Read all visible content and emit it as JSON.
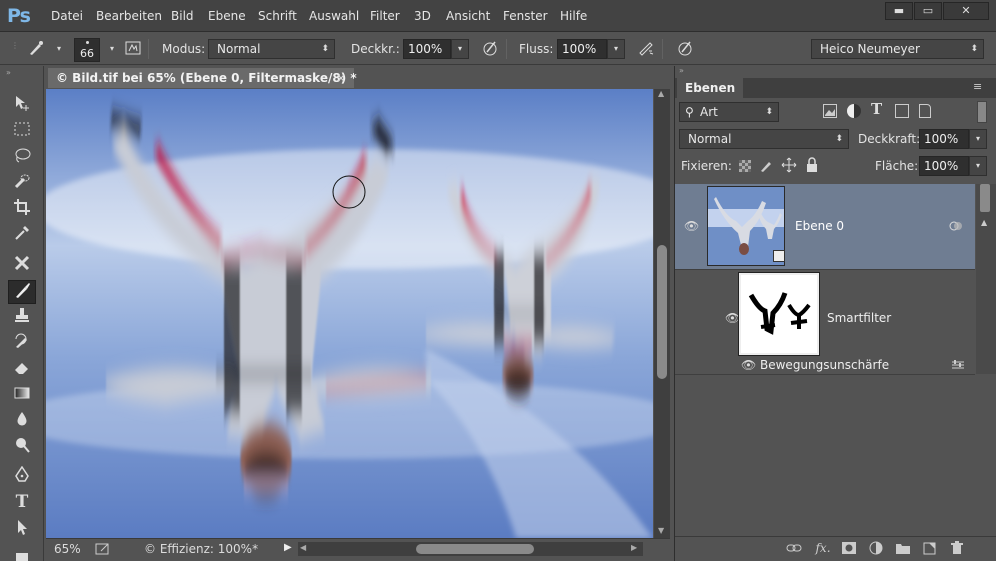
{
  "app": {
    "logo": "Ps"
  },
  "menu": [
    "Datei",
    "Bearbeiten",
    "Bild",
    "Ebene",
    "Schrift",
    "Auswahl",
    "Filter",
    "3D",
    "Ansicht",
    "Fenster",
    "Hilfe"
  ],
  "window_controls": {
    "minimize": "▬",
    "maximize": "▭",
    "close": "✕"
  },
  "options": {
    "brush_size": "66",
    "mode_label": "Modus:",
    "mode_value": "Normal",
    "opacity_label": "Deckkr.:",
    "opacity_value": "100%",
    "flow_label": "Fluss:",
    "flow_value": "100%",
    "workspace": "Heico Neumeyer"
  },
  "document": {
    "tab_title": "© Bild.tif bei 65% (Ebene 0, Filtermaske/8) *",
    "close": "×",
    "zoom": "65%",
    "status": "© Effizienz: 100%*"
  },
  "layers_panel": {
    "tab": "Ebenen",
    "filter_kind": "Art",
    "blend_mode": "Normal",
    "opacity_label": "Deckkraft:",
    "opacity_value": "100%",
    "lock_label": "Fixieren:",
    "fill_label": "Fläche:",
    "fill_value": "100%",
    "layers": [
      {
        "name": "Ebene 0"
      },
      {
        "name": "Smartfilter"
      },
      {
        "name": "Bewegungsunschärfe"
      }
    ]
  },
  "colors": {
    "accent_selected_layer": "#6f7d92",
    "logo": "#7fb8e8",
    "sky": "#6f8fc6"
  }
}
